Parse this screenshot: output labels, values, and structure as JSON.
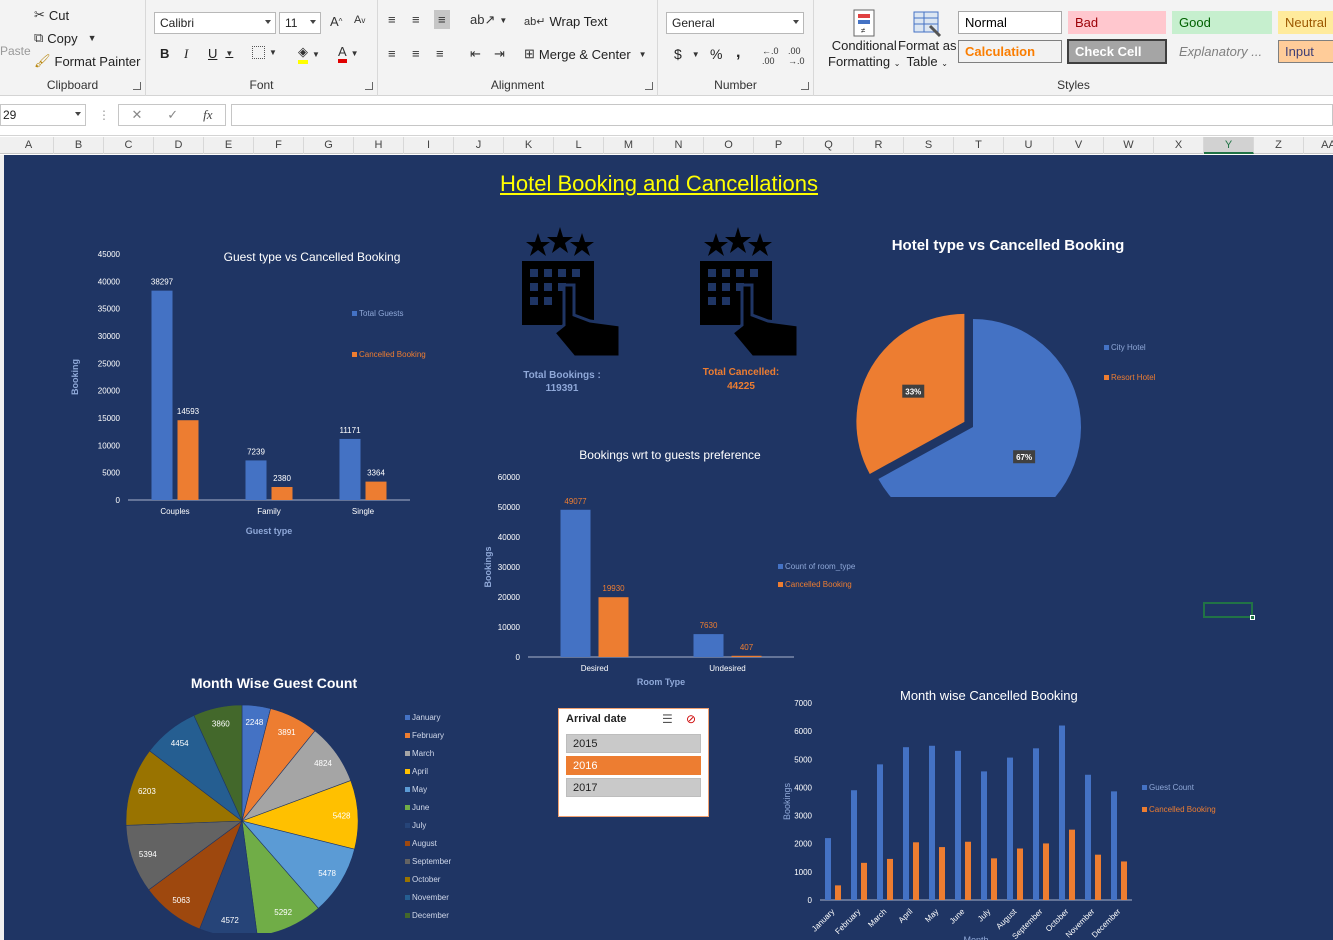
{
  "ribbon": {
    "clipboard": {
      "paste": "Paste",
      "cut": "Cut",
      "copy": "Copy",
      "format_painter": "Format Painter",
      "label": "Clipboard"
    },
    "font": {
      "name": "Calibri",
      "size": "11",
      "label": "Font",
      "bold": "B",
      "italic": "I",
      "underline": "U",
      "font_color_letter": "A"
    },
    "alignment": {
      "wrap_text": "Wrap Text",
      "merge_center": "Merge & Center",
      "label": "Alignment"
    },
    "number": {
      "format": "General",
      "currency": "$",
      "percent": "%",
      "comma": ",",
      "label": "Number"
    },
    "conditional_formatting": [
      "Conditional",
      "Formatting"
    ],
    "format_as_table": [
      "Format as",
      "Table"
    ],
    "styles": {
      "label": "Styles",
      "items": [
        {
          "label": "Normal",
          "bg": "#ffffff",
          "fg": "#000000",
          "border": "#a8a8a8"
        },
        {
          "label": "Bad",
          "bg": "#ffc7ce",
          "fg": "#9c0006",
          "border": "#ffc7ce"
        },
        {
          "label": "Good",
          "bg": "#c6efce",
          "fg": "#006100",
          "border": "#c6efce"
        },
        {
          "label": "Neutral",
          "bg": "#ffeb9c",
          "fg": "#9c5700",
          "border": "#ffeb9c"
        },
        {
          "label": "Calculation",
          "bg": "#f2f2f2",
          "fg": "#fa7d00",
          "border": "#7f7f7f"
        },
        {
          "label": "Check Cell",
          "bg": "#a5a5a5",
          "fg": "#ffffff",
          "border": "#3f3f3f"
        },
        {
          "label": "Explanatory ...",
          "bg": "#f3f3f3",
          "fg": "#7f7f7f",
          "border": "#f3f3f3"
        },
        {
          "label": "Input",
          "bg": "#ffcc99",
          "fg": "#3f3f76",
          "border": "#7f7f7f"
        }
      ]
    }
  },
  "formula_bar": {
    "name_box": "29",
    "fx": "fx",
    "value": ""
  },
  "columns": [
    "A",
    "B",
    "C",
    "D",
    "E",
    "F",
    "G",
    "H",
    "I",
    "J",
    "K",
    "L",
    "M",
    "N",
    "O",
    "P",
    "Q",
    "R",
    "S",
    "T",
    "U",
    "V",
    "W",
    "X",
    "Y",
    "Z",
    "AA"
  ],
  "selected_column": "Y",
  "dashboard": {
    "title": "Hotel Booking and Cancellations",
    "kpis": [
      {
        "label": "Total Bookings :",
        "value": "119391",
        "color": "#8fa8d8"
      },
      {
        "label": "Total Cancelled:",
        "value": "44225",
        "color": "#ed7d31"
      }
    ],
    "slicer": {
      "title": "Arrival date",
      "items": [
        "2015",
        "2016",
        "2017"
      ],
      "selected": "2016"
    }
  },
  "chart_data": [
    {
      "type": "bar",
      "title": "Guest type vs Cancelled Booking",
      "xlabel": "Guest type",
      "ylabel": "Booking",
      "categories": [
        "Couples",
        "Family",
        "Single"
      ],
      "series": [
        {
          "name": "Total Guests",
          "values": [
            38297,
            7239,
            11171
          ],
          "color": "#4472c4"
        },
        {
          "name": "Cancelled Booking",
          "values": [
            14593,
            2380,
            3364
          ],
          "color": "#ed7d31"
        }
      ],
      "ylim": [
        0,
        45000
      ],
      "yticks": [
        0,
        5000,
        10000,
        15000,
        20000,
        25000,
        30000,
        35000,
        40000,
        45000
      ],
      "legend": "right"
    },
    {
      "type": "pie",
      "title": "Hotel type vs Cancelled Booking",
      "labels": [
        "City Hotel",
        "Resort Hotel"
      ],
      "values": [
        67,
        33
      ],
      "value_labels": [
        "67%",
        "33%"
      ],
      "colors": [
        "#4472c4",
        "#ed7d31"
      ],
      "legend": "right"
    },
    {
      "type": "bar",
      "title": "Bookings wrt to guests preference",
      "xlabel": "Room Type",
      "ylabel": "Bookings",
      "categories": [
        "Desired",
        "Undesired"
      ],
      "series": [
        {
          "name": "Count of room_type",
          "values": [
            49077,
            7630
          ],
          "color": "#4472c4"
        },
        {
          "name": "Cancelled Booking",
          "values": [
            19930,
            407
          ],
          "color": "#ed7d31"
        }
      ],
      "ylim": [
        0,
        60000
      ],
      "yticks": [
        0,
        10000,
        20000,
        30000,
        40000,
        50000,
        60000
      ],
      "legend": "right"
    },
    {
      "type": "pie",
      "title": "Month Wise Guest Count",
      "labels": [
        "January",
        "February",
        "March",
        "April",
        "May",
        "June",
        "July",
        "August",
        "September",
        "October",
        "November",
        "December"
      ],
      "values": [
        2248,
        3891,
        4824,
        5428,
        5478,
        5292,
        4572,
        5063,
        5394,
        6203,
        4454,
        3860
      ],
      "colors": [
        "#4472c4",
        "#ed7d31",
        "#a5a5a5",
        "#ffc000",
        "#5b9bd5",
        "#70ad47",
        "#264478",
        "#9e480e",
        "#636363",
        "#997300",
        "#255e91",
        "#43682b"
      ],
      "legend": "right"
    },
    {
      "type": "bar",
      "title": "Month wise Cancelled Booking",
      "xlabel": "Month",
      "ylabel": "Bookings",
      "categories": [
        "January",
        "February",
        "March",
        "April",
        "May",
        "June",
        "July",
        "August",
        "September",
        "October",
        "November",
        "December"
      ],
      "series": [
        {
          "name": "Guest Count",
          "values": [
            2200,
            3900,
            4820,
            5430,
            5480,
            5300,
            4570,
            5060,
            5390,
            6200,
            4450,
            3860
          ],
          "color": "#4472c4"
        },
        {
          "name": "Cancelled Booking",
          "values": [
            520,
            1320,
            1460,
            2050,
            1880,
            2070,
            1480,
            1830,
            2010,
            2500,
            1610,
            1370
          ],
          "color": "#ed7d31"
        }
      ],
      "ylim": [
        0,
        7000
      ],
      "yticks": [
        0,
        1000,
        2000,
        3000,
        4000,
        5000,
        6000,
        7000
      ],
      "legend": "right"
    }
  ]
}
